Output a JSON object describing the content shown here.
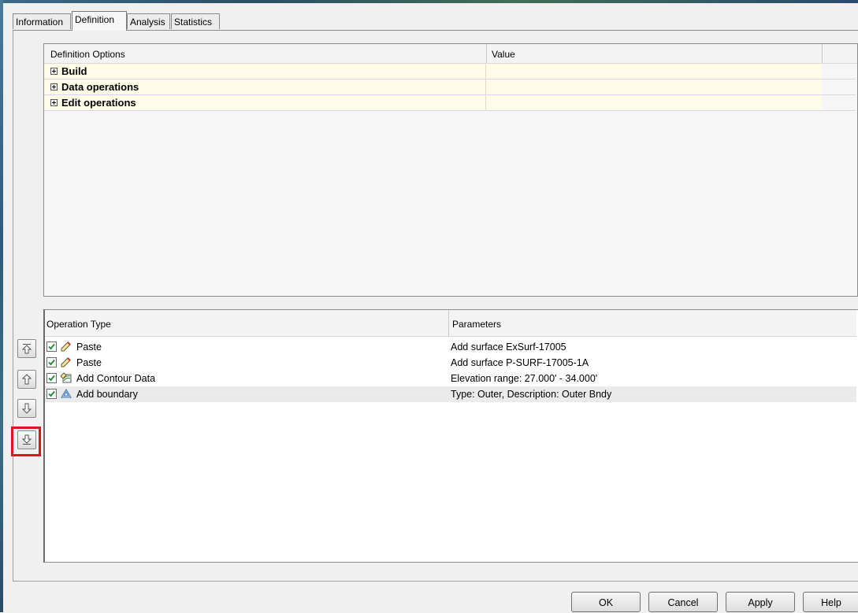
{
  "tabs": [
    "Information",
    "Definition",
    "Analysis",
    "Statistics"
  ],
  "active_tab": "Definition",
  "definition_grid": {
    "headers": [
      "Definition Options",
      "Value"
    ],
    "rows": [
      "Build",
      "Data operations",
      "Edit operations"
    ]
  },
  "operations_grid": {
    "headers": [
      "Operation Type",
      "Parameters"
    ],
    "rows": [
      {
        "type": "Paste",
        "params": "Add surface ExSurf-17005",
        "icon": "paste-icon",
        "checked": true
      },
      {
        "type": "Paste",
        "params": "Add surface P-SURF-17005-1A",
        "icon": "paste-icon",
        "checked": true
      },
      {
        "type": "Add Contour Data",
        "params": "Elevation range: 27.000' - 34.000'",
        "icon": "contour-data-icon",
        "checked": true
      },
      {
        "type": "Add boundary",
        "params": "Type: Outer,  Description: Outer Bndy",
        "icon": "boundary-icon",
        "checked": true,
        "selected": true
      }
    ]
  },
  "side_buttons": [
    "move-to-top-icon",
    "move-up-icon",
    "move-down-icon",
    "move-to-bottom-icon"
  ],
  "highlight_color": "#e0141e",
  "buttons": {
    "ok": "OK",
    "cancel": "Cancel",
    "apply": "Apply",
    "help": "Help"
  }
}
